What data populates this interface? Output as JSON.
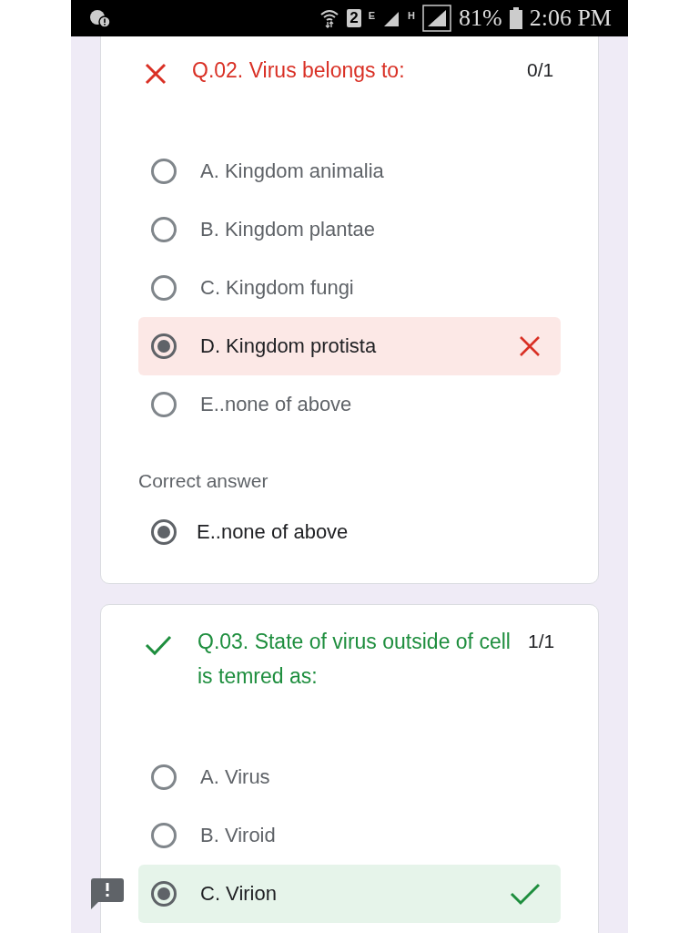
{
  "status_bar": {
    "sim": "2",
    "network_1": "E",
    "network_2": "H",
    "battery": "81%",
    "time": "2:06 PM"
  },
  "questions": [
    {
      "correct": false,
      "title": "Q.02. Virus belongs to:",
      "score": "0/1",
      "options": [
        {
          "label": "A. Kingdom animalia",
          "selected": false
        },
        {
          "label": "B. Kingdom plantae",
          "selected": false
        },
        {
          "label": "C. Kingdom fungi",
          "selected": false
        },
        {
          "label": "D. Kingdom protista",
          "selected": true
        },
        {
          "label": "E..none of above",
          "selected": false
        }
      ],
      "correct_answer_label": "Correct answer",
      "correct_answer": {
        "label": "E..none of above",
        "selected": true
      }
    },
    {
      "correct": true,
      "title": "Q.03. State of virus outside of cell is temred as:",
      "score": "1/1",
      "options": [
        {
          "label": "A. Virus",
          "selected": false
        },
        {
          "label": "B. Viroid",
          "selected": false
        },
        {
          "label": "C. Virion",
          "selected": true
        }
      ]
    }
  ]
}
